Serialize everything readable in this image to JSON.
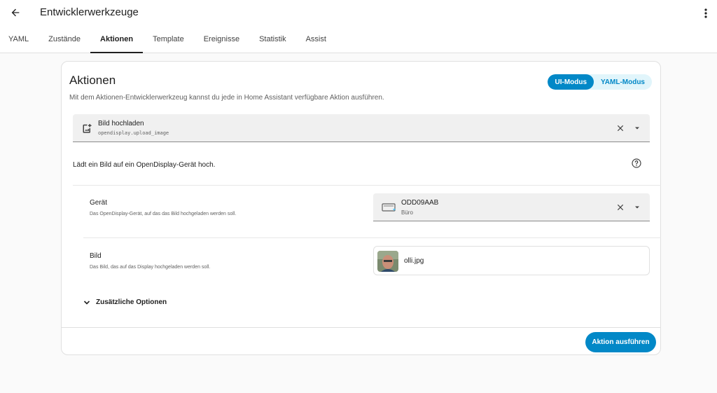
{
  "header": {
    "title": "Entwicklerwerkzeuge",
    "back_icon": "arrow-left-icon",
    "menu_icon": "dots-vertical-icon"
  },
  "tabs": [
    {
      "label": "YAML",
      "active": false
    },
    {
      "label": "Zustände",
      "active": false
    },
    {
      "label": "Aktionen",
      "active": true
    },
    {
      "label": "Template",
      "active": false
    },
    {
      "label": "Ereignisse",
      "active": false
    },
    {
      "label": "Statistik",
      "active": false
    },
    {
      "label": "Assist",
      "active": false
    }
  ],
  "card": {
    "title": "Aktionen",
    "description": "Mit dem Aktionen-Entwicklerwerkzeug kannst du jede in Home Assistant verfügbare Aktion ausführen.",
    "mode_ui": "UI-Modus",
    "mode_yaml": "YAML-Modus",
    "active_mode": "UI-Modus"
  },
  "action_select": {
    "icon": "image-upload-icon",
    "name": "Bild hochladen",
    "id": "opendisplay.upload_image"
  },
  "action_description": "Lädt ein Bild auf ein OpenDisplay-Gerät hoch.",
  "fields": {
    "device": {
      "label": "Gerät",
      "help": "Das OpenDisplay-Gerät, auf das das Bild hochgeladen werden soll.",
      "value_name": "ODD09AAB",
      "value_area": "Büro",
      "icon": "display-device-icon"
    },
    "image": {
      "label": "Bild",
      "help": "Das Bild, das auf das Display hochgeladen werden soll.",
      "value": "olli.jpg"
    }
  },
  "extra_options_label": "Zusätzliche Optionen",
  "run_button_label": "Aktion ausführen",
  "colors": {
    "accent": "#0288c7",
    "accent_light": "#e1f5fb",
    "background": "#fafafa"
  }
}
